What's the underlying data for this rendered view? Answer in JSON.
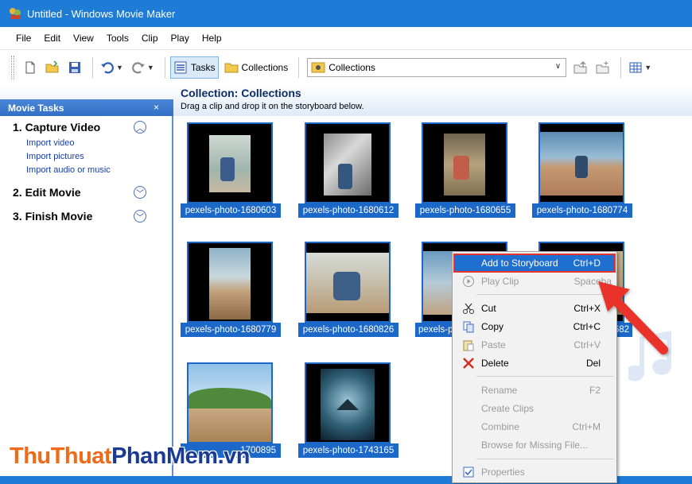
{
  "window": {
    "title": "Untitled - Windows Movie Maker"
  },
  "menu": [
    "File",
    "Edit",
    "View",
    "Tools",
    "Clip",
    "Play",
    "Help"
  ],
  "toolbar": {
    "tasks_label": "Tasks",
    "collections_label": "Collections",
    "collections_combo": "Collections"
  },
  "task_pane": {
    "header": "Movie Tasks",
    "close": "×",
    "sections": [
      {
        "title": "1. Capture Video",
        "links": [
          "Import video",
          "Import pictures",
          "Import audio or music"
        ]
      },
      {
        "title": "2. Edit Movie"
      },
      {
        "title": "3. Finish Movie"
      }
    ]
  },
  "collection": {
    "title": "Collection: Collections",
    "subtitle": "Drag a clip and drop it on the storyboard below."
  },
  "clips": [
    "pexels-photo-1680603",
    "pexels-photo-1680612",
    "pexels-photo-1680655",
    "pexels-photo-1680774",
    "pexels-photo-1680779",
    "pexels-photo-1680826",
    "pexels-ph",
    "682",
    "",
    "pexels-photo-1743165"
  ],
  "clip9_partial": "1700895",
  "context_menu": [
    {
      "label": "Add to Storyboard",
      "shortcut": "Ctrl+D"
    },
    {
      "label": "Play Clip",
      "shortcut": "Spaceba"
    },
    {
      "label": "Cut",
      "shortcut": "Ctrl+X"
    },
    {
      "label": "Copy",
      "shortcut": "Ctrl+C"
    },
    {
      "label": "Paste",
      "shortcut": "Ctrl+V"
    },
    {
      "label": "Delete",
      "shortcut": "Del"
    },
    {
      "label": "Rename",
      "shortcut": "F2"
    },
    {
      "label": "Create Clips",
      "shortcut": ""
    },
    {
      "label": "Combine",
      "shortcut": "Ctrl+M"
    },
    {
      "label": "Browse for Missing File...",
      "shortcut": ""
    },
    {
      "label": "Properties",
      "shortcut": ""
    }
  ],
  "watermark": {
    "part1": "ThuThuat",
    "part2": "PhanMem",
    "part3": ".vn"
  },
  "colors": {
    "accent": "#1e7bd6",
    "selection": "#1c68c8",
    "highlight_border": "#e8332a"
  }
}
